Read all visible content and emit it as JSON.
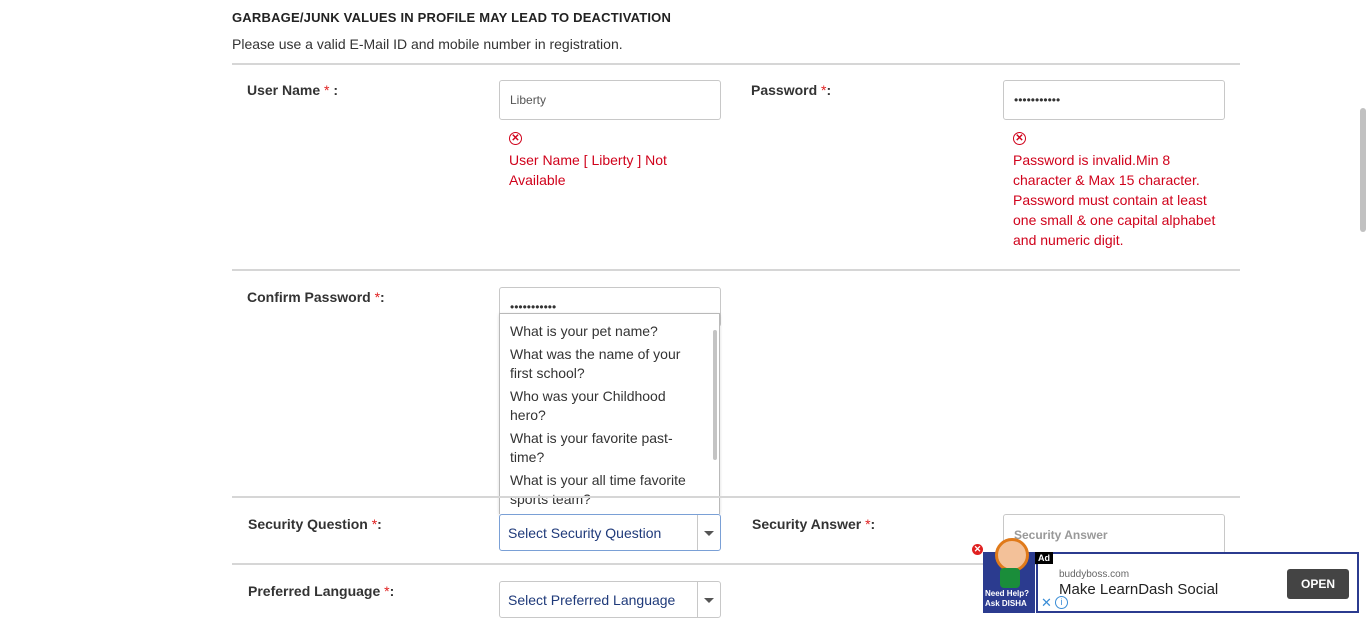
{
  "notice": {
    "title": "GARBAGE/JUNK VALUES IN PROFILE MAY LEAD TO DEACTIVATION",
    "subtitle": "Please use a valid E-Mail ID and mobile number in registration."
  },
  "form": {
    "username": {
      "label": "User Name",
      "required_mark": "*",
      "suffix": " :",
      "value": "Liberty",
      "error": "User Name [ Liberty ] Not Available"
    },
    "password": {
      "label": "Password",
      "required_mark": "*",
      "suffix": ":",
      "value": "•••••••••••",
      "error": "Password is invalid.Min 8 character & Max 15 character. Password must contain at least one small & one capital alphabet and numeric digit."
    },
    "confirm_password": {
      "label": "Confirm Password",
      "required_mark": "*",
      "suffix": ":",
      "value": "•••••••••••"
    },
    "security_question": {
      "label": "Security Question",
      "required_mark": "*",
      "suffix": ":",
      "selected": "Select Security Question",
      "options": [
        "What is your pet name?",
        "What was the name of your first school?",
        "Who was your Childhood hero?",
        "What is your favorite past-time?",
        "What is your all time favorite sports team?"
      ]
    },
    "security_answer": {
      "label": "Security Answer",
      "required_mark": "*",
      "suffix": ":",
      "placeholder": "Security Answer"
    },
    "preferred_language": {
      "label": "Preferred Language",
      "required_mark": "*",
      "suffix": ":",
      "selected": "Select Preferred Language"
    }
  },
  "ad": {
    "tag": "Ad",
    "domain": "buddyboss.com",
    "title": "Make LearnDash Social",
    "button": "OPEN",
    "help_text": "Need Help? Ask DISHA",
    "close_glyph": "✕",
    "info_glyph": "i"
  },
  "colors": {
    "error": "#d0021b",
    "required": "#e02020",
    "select_text": "#1f3a7a",
    "ad_border": "#2b3b8f"
  }
}
